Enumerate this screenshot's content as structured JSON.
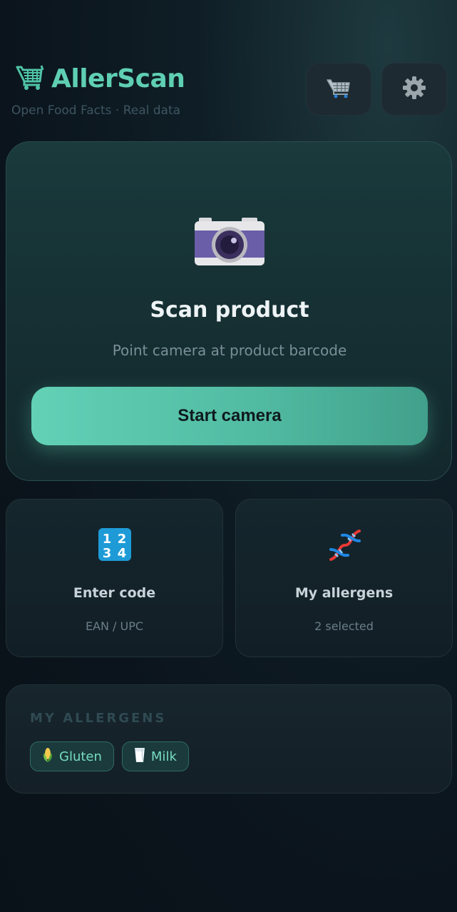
{
  "header": {
    "app_name": "AllerScan",
    "subtitle": "Open Food Facts · Real data",
    "brand_icon": "shopping-cart-icon",
    "cart_button_icon": "shopping-cart-icon",
    "settings_button_icon": "gear-icon"
  },
  "scan_card": {
    "icon": "camera-icon",
    "title": "Scan product",
    "subtitle": "Point camera at product barcode",
    "button_label": "Start camera"
  },
  "actions": [
    {
      "icon": "keycap-digits-icon",
      "title": "Enter code",
      "subtitle": "EAN / UPC"
    },
    {
      "icon": "dna-icon",
      "title": "My allergens",
      "subtitle": "2 selected"
    }
  ],
  "allergens": {
    "heading": "MY ALLERGENS",
    "items": [
      {
        "icon": "corn-icon",
        "label": "Gluten"
      },
      {
        "icon": "milk-glass-icon",
        "label": "Milk"
      }
    ]
  },
  "colors": {
    "accent": "#5fcfb3",
    "background": "#0b141c",
    "chip_bg": "#1a3a3b"
  }
}
